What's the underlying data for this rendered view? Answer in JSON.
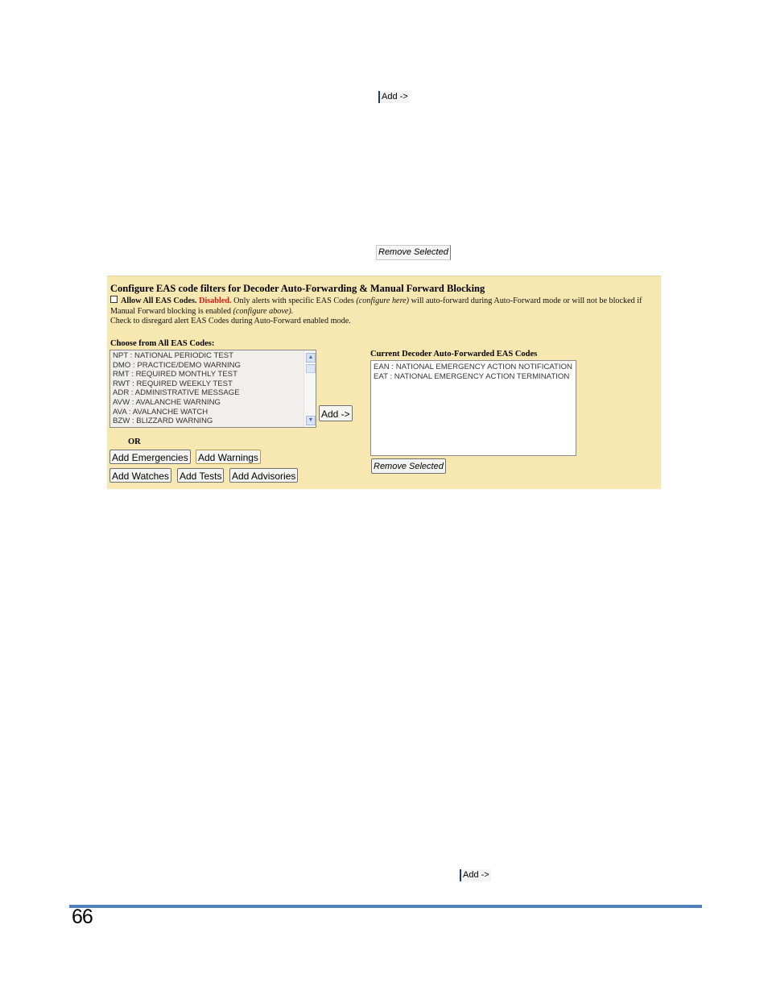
{
  "inline_buttons": {
    "add_top": "Add ->",
    "remove_mid": "Remove Selected",
    "add_bottom": "Add ->"
  },
  "panel": {
    "title": "Configure EAS code filters for Decoder Auto-Forwarding & Manual Forward Blocking",
    "allow_all_label": "Allow All EAS Codes.",
    "status": "Disabled.",
    "desc_part1": "Only alerts with specific EAS Codes",
    "configure_here": "(configure here)",
    "desc_part2": "will auto-forward during Auto-Forward mode or will not be blocked if Manual Forward blocking is enabled",
    "configure_above": "(configure above).",
    "desc_line3": "Check to disregard alert EAS Codes during Auto-Forward enabled mode.",
    "status_color": "#d41a1a",
    "bg_color": "#f7e7b1"
  },
  "all_codes": {
    "label": "Choose from All EAS Codes:",
    "items": [
      "NPT : NATIONAL PERIODIC TEST",
      "DMO : PRACTICE/DEMO WARNING",
      "RMT : REQUIRED MONTHLY TEST",
      "RWT : REQUIRED WEEKLY TEST",
      "ADR : ADMINISTRATIVE MESSAGE",
      "AVW : AVALANCHE WARNING",
      "AVA : AVALANCHE WATCH",
      "BZW : BLIZZARD WARNING"
    ],
    "add_button": "Add ->",
    "or_label": "OR"
  },
  "group_buttons": {
    "emergencies": "Add Emergencies",
    "warnings": "Add Warnings",
    "watches": "Add Watches",
    "tests": "Add Tests",
    "advisories": "Add Advisories"
  },
  "current_codes": {
    "label": "Current Decoder Auto-Forwarded EAS Codes",
    "items": [
      "EAN : NATIONAL EMERGENCY ACTION NOTIFICATION",
      "EAT : NATIONAL EMERGENCY ACTION TERMINATION"
    ],
    "remove_button": "Remove Selected"
  },
  "footer": {
    "page_number": "66",
    "rule_color": "#4f81bd"
  }
}
